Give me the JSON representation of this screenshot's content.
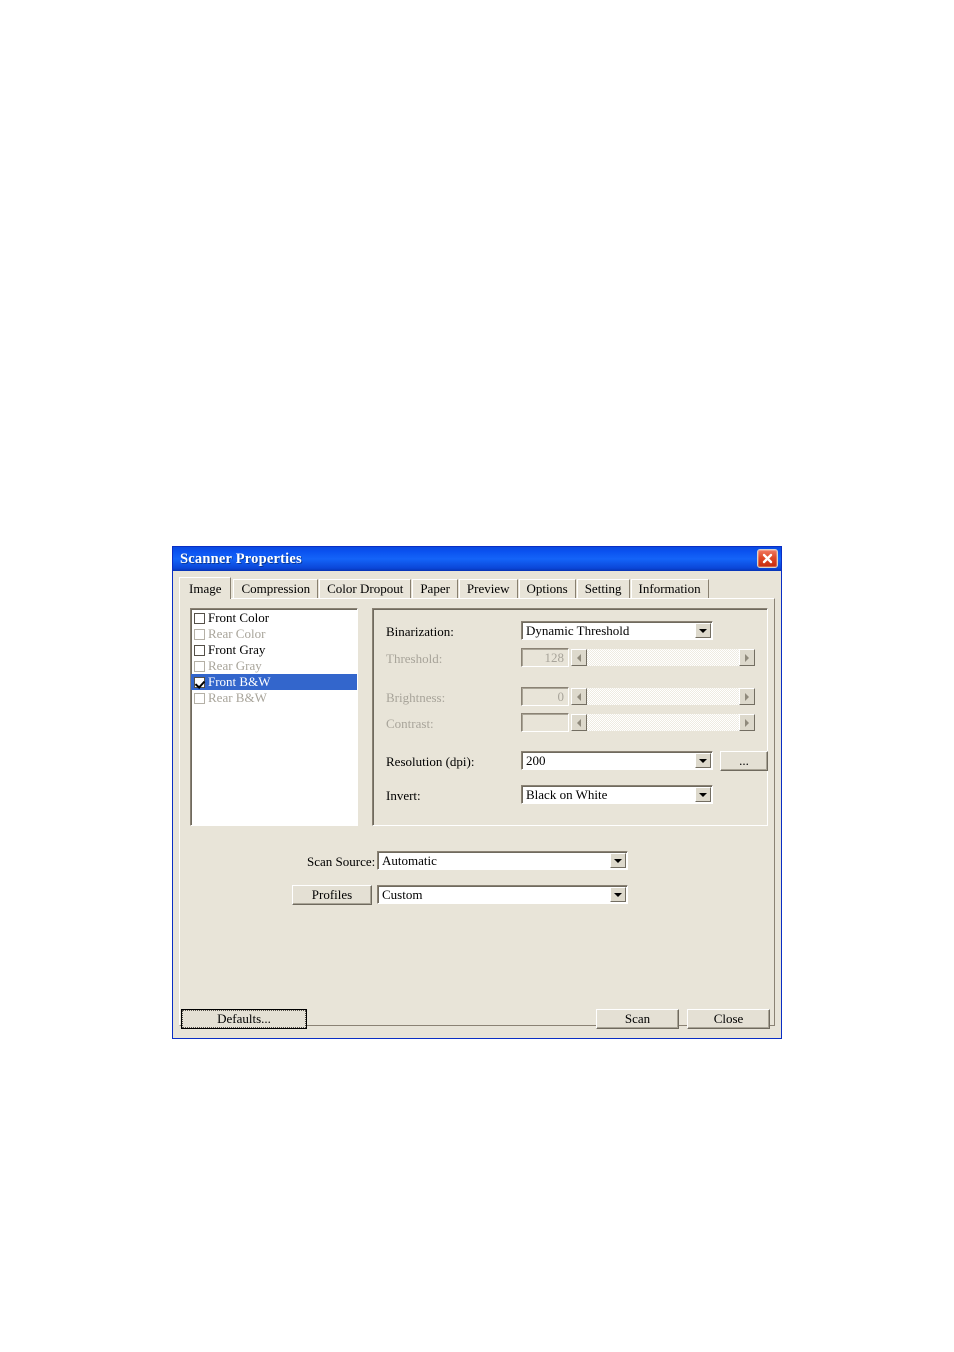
{
  "window": {
    "title": "Scanner Properties",
    "close_icon": "close-icon"
  },
  "tabs": [
    {
      "label": "Image",
      "selected": true
    },
    {
      "label": "Compression",
      "selected": false
    },
    {
      "label": "Color Dropout",
      "selected": false
    },
    {
      "label": "Paper",
      "selected": false
    },
    {
      "label": "Preview",
      "selected": false
    },
    {
      "label": "Options",
      "selected": false
    },
    {
      "label": "Setting",
      "selected": false
    },
    {
      "label": "Information",
      "selected": false
    }
  ],
  "image_selection_list": [
    {
      "label": "Front Color",
      "checked": false,
      "disabled": false,
      "selected": false
    },
    {
      "label": "Rear Color",
      "checked": false,
      "disabled": true,
      "selected": false
    },
    {
      "label": "Front Gray",
      "checked": false,
      "disabled": false,
      "selected": false
    },
    {
      "label": "Rear Gray",
      "checked": false,
      "disabled": true,
      "selected": false
    },
    {
      "label": "Front B&W",
      "checked": true,
      "disabled": false,
      "selected": true
    },
    {
      "label": "Rear B&W",
      "checked": false,
      "disabled": true,
      "selected": false
    }
  ],
  "settings": {
    "binarization": {
      "label": "Binarization:",
      "value": "Dynamic Threshold",
      "disabled": false
    },
    "threshold": {
      "label": "Threshold:",
      "value": "128",
      "disabled": true
    },
    "brightness": {
      "label": "Brightness:",
      "value": "0",
      "disabled": true
    },
    "contrast": {
      "label": "Contrast:",
      "value": "",
      "disabled": true
    },
    "resolution": {
      "label": "Resolution (dpi):",
      "value": "200",
      "more_button": "..."
    },
    "invert": {
      "label": "Invert:",
      "value": "Black on White"
    }
  },
  "scan_source": {
    "label": "Scan Source:",
    "value": "Automatic"
  },
  "profiles": {
    "button_label": "Profiles",
    "value": "Custom"
  },
  "footer": {
    "defaults_label": "Defaults...",
    "scan_label": "Scan",
    "close_label": "Close"
  },
  "colors": {
    "titlebar_blue": "#0a52f0",
    "dialog_face": "#e8e4d8",
    "selection_blue": "#3366cc",
    "close_red": "#e04a28",
    "disabled_text": "#a8a49a"
  }
}
